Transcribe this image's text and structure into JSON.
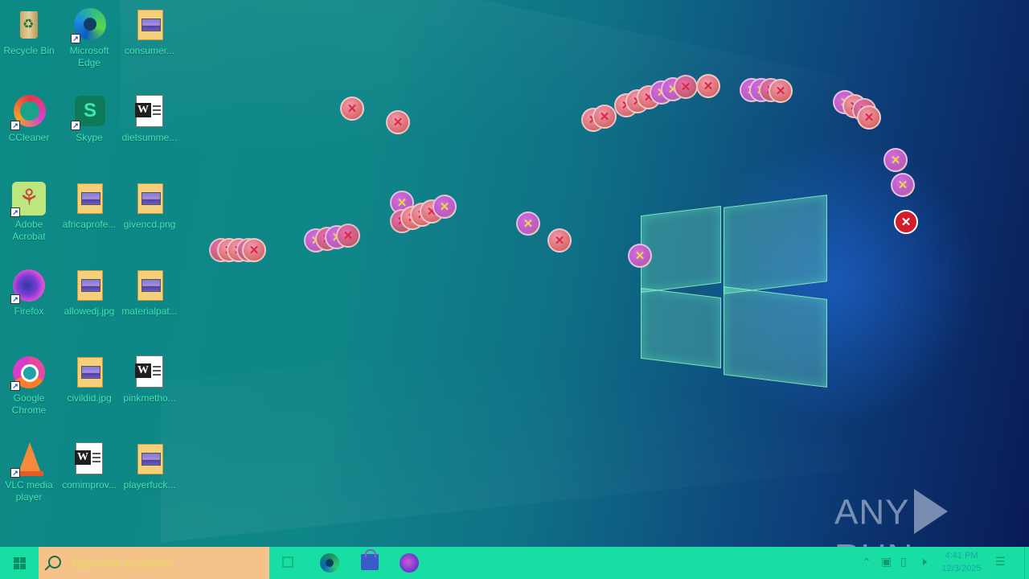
{
  "desktop": {
    "icons": [
      {
        "label": "Recycle Bin"
      },
      {
        "label": "Microsoft Edge"
      },
      {
        "label": "consumer..."
      },
      {
        "label": "CCleaner"
      },
      {
        "label": "Skype"
      },
      {
        "label": "dietsumme..."
      },
      {
        "label": "Adobe Acrobat"
      },
      {
        "label": "africaprofe..."
      },
      {
        "label": "givencd.png"
      },
      {
        "label": "Firefox"
      },
      {
        "label": "allowedj.jpg"
      },
      {
        "label": "materialpat..."
      },
      {
        "label": "Google Chrome"
      },
      {
        "label": "civildid.jpg"
      },
      {
        "label": "pinkmetho..."
      },
      {
        "label": "VLC media player"
      },
      {
        "label": "comimprov..."
      },
      {
        "label": "playerfuck..."
      }
    ]
  },
  "watermark": {
    "left": "ANY",
    "right": "RUN"
  },
  "taskbar": {
    "search_placeholder": "Type here to search",
    "clock_time": "4:41 PM",
    "clock_date": "12/3/2025"
  },
  "colors": {
    "taskbar": "#19dea4",
    "search_box": "#f5c38a",
    "icon_label": "#3fe6b5",
    "error_red": "#d21e2b"
  },
  "icon_names": [
    "recycle-bin-icon",
    "edge-icon",
    "image-file-icon",
    "ccleaner-icon",
    "skype-icon",
    "word-doc-icon",
    "acrobat-icon",
    "firefox-icon",
    "chrome-icon",
    "vlc-icon",
    "error-icon"
  ]
}
